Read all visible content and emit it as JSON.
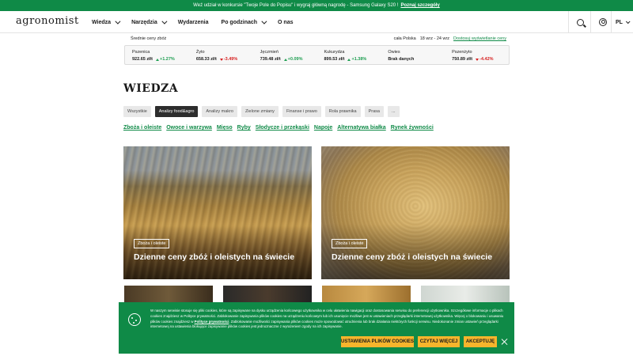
{
  "promo": {
    "text": "Weź udział w konkursie \"Twoje Pole do Popisu\" i wygraj główną nagrodę - Samsung Galaxy S20 !",
    "link": "Poznaj szczegóły"
  },
  "header": {
    "logo": "agronomist",
    "nav": [
      "Wiedza",
      "Narzędzia",
      "Wydarzenia",
      "Po godzinach",
      "O nas"
    ],
    "language": "PL"
  },
  "prices": {
    "title": "Średnie ceny zbóż",
    "region": "cała Polska",
    "period": "18 wrz - 24 wrz",
    "details_link": "Dostosuj wyświetlanie ceny",
    "items": [
      {
        "name": "Pszenica",
        "price": "922.65 zł/t",
        "change": "+1.27%",
        "direction": "up"
      },
      {
        "name": "Żyto",
        "price": "658.33 zł/t",
        "change": "-3.49%",
        "direction": "down"
      },
      {
        "name": "Jęczmień",
        "price": "739.48 zł/t",
        "change": "+0.09%",
        "direction": "up"
      },
      {
        "name": "Kukurydza",
        "price": "899.53 zł/t",
        "change": "+1.38%",
        "direction": "up"
      },
      {
        "name": "Owies",
        "price": "Brak danych",
        "change": "",
        "direction": "none"
      },
      {
        "name": "Pszenżyto",
        "price": "750.89 zł/t",
        "change": "-4.42%",
        "direction": "down"
      }
    ]
  },
  "page_title": "WIEDZA",
  "tabs": [
    "Wszystkie",
    "Analizy food&agro",
    "Analizy makro",
    "Zielone zmiany",
    "Finanse i prawo",
    "Rola prawnika",
    "Prasa",
    "..."
  ],
  "categories": [
    "Zboża i oleiste",
    "Owoce i warzywa",
    "Mięso",
    "Ryby",
    "Słodycze i przekąski",
    "Napoje",
    "Alternatywa białka",
    "Rynek żywności"
  ],
  "cards": [
    {
      "badge": "Zboża i oleiste",
      "title": "Dzienne ceny zbóż i oleistych na świecie"
    },
    {
      "badge": "Zboża i oleiste",
      "title": "Dzienne ceny zbóż i oleistych na świecie"
    }
  ],
  "cookie": {
    "text_1": "W naszym serwisie stosuje się pliki cookies, które są zapisywane na dysku urządzenia końcowego użytkownika w celu ułatwienia nawigacji oraz dostosowania serwisu do preferencji użytkownika. Szczegółowe informacje o plikach cookies znajdziesz w Polityce prywatności. Zablokowanie zapisywania plików cookies na urządzeniu końcowym lub ich usunięcie możliwe jest w ustawieniach przeglądarki internetowej użytkownika. Więcej o blokowaniu i usuwaniu plików cookies znajdziesz w",
    "text_link": "Polityce prywatności",
    "text_2": ". Zablokowanie możliwości zapisywania plików cookies może spowodować utrudnienia lub brak działania niektórych funkcji serwisu. Niedokonanie zmian ustawień przeglądarki internetowej na ustawienia blokujące zapisywanie plików cookies jest jednoznaczne z wyrażeniem zgody na ich zapisywanie.",
    "settings_button": "USTAWIENIA PLIKÓW COOKIES",
    "read_more_button": "CZYTAJ WIĘCEJ",
    "accept_button": "AKCEPTUJĘ"
  }
}
